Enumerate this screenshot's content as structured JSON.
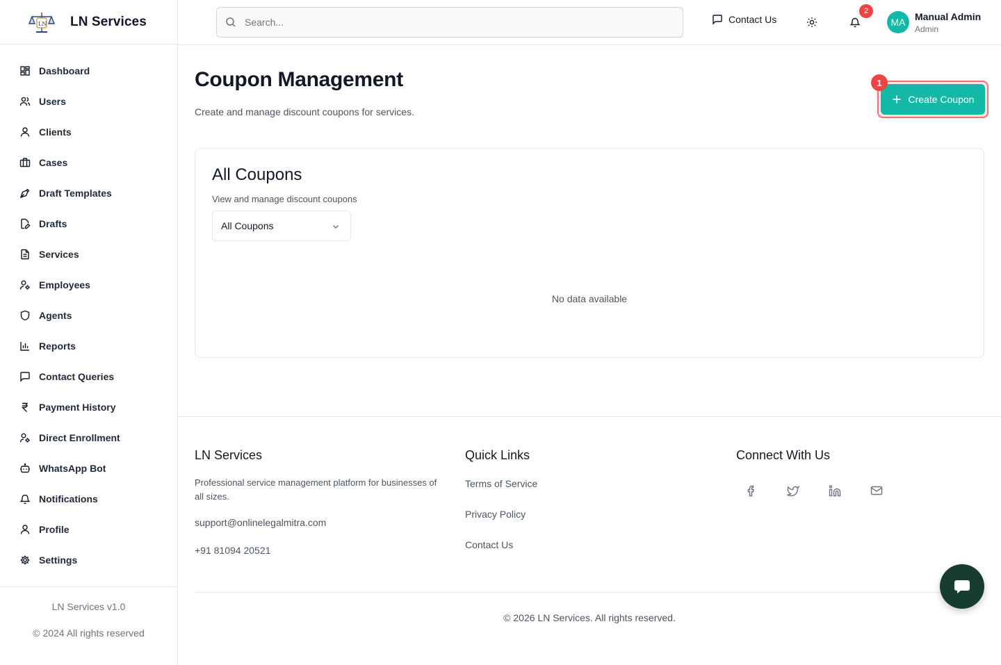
{
  "brand": {
    "name": "LN Services"
  },
  "sidebar": {
    "items": [
      {
        "label": "Dashboard",
        "icon": "dashboard-icon"
      },
      {
        "label": "Users",
        "icon": "users-icon"
      },
      {
        "label": "Clients",
        "icon": "user-icon"
      },
      {
        "label": "Cases",
        "icon": "briefcase-icon"
      },
      {
        "label": "Draft Templates",
        "icon": "pen-tool-icon"
      },
      {
        "label": "Drafts",
        "icon": "file-edit-icon"
      },
      {
        "label": "Services",
        "icon": "file-text-icon"
      },
      {
        "label": "Employees",
        "icon": "user-cog-icon"
      },
      {
        "label": "Agents",
        "icon": "shield-icon"
      },
      {
        "label": "Reports",
        "icon": "bar-chart-icon"
      },
      {
        "label": "Contact Queries",
        "icon": "message-square-icon"
      },
      {
        "label": "Payment History",
        "icon": "rupee-icon"
      },
      {
        "label": "Direct Enrollment",
        "icon": "user-cog-icon"
      },
      {
        "label": "WhatsApp Bot",
        "icon": "bot-icon"
      },
      {
        "label": "Notifications",
        "icon": "bell-icon"
      },
      {
        "label": "Profile",
        "icon": "user-icon"
      },
      {
        "label": "Settings",
        "icon": "gear-icon"
      }
    ],
    "version": "LN Services v1.0",
    "copyright": "© 2024 All rights reserved"
  },
  "header": {
    "search_placeholder": "Search...",
    "contact_label": "Contact Us",
    "notification_count": "2",
    "avatar_initials": "MA",
    "user_name": "Manual Admin",
    "user_role": "Admin"
  },
  "main": {
    "title": "Coupon Management",
    "subtitle": "Create and manage discount coupons for services.",
    "create_button": "Create Coupon",
    "step_badge": "1",
    "card": {
      "title": "All Coupons",
      "subtitle": "View and manage discount coupons",
      "filter_value": "All Coupons",
      "empty_text": "No data available"
    }
  },
  "footer": {
    "brand": "LN Services",
    "description": "Professional service management platform for businesses of all sizes.",
    "email": "support@onlinelegalmitra.com",
    "phone": "+91 81094 20521",
    "quick_links_title": "Quick Links",
    "links": [
      "Terms of Service",
      "Privacy Policy",
      "Contact Us"
    ],
    "connect_title": "Connect With Us",
    "copyright": "© 2026 LN Services. All rights reserved."
  },
  "colors": {
    "accent": "#14b8a6",
    "highlight": "#ef4444",
    "chat_fab": "#163d2d"
  }
}
